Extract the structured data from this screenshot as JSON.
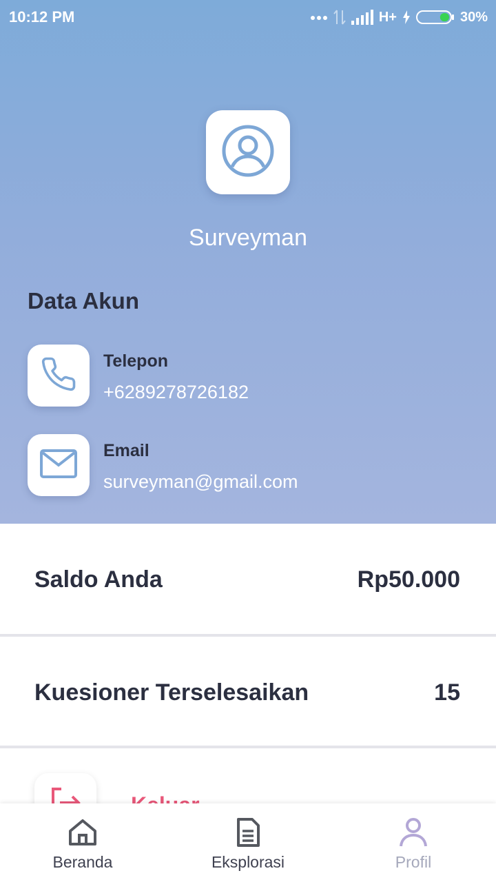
{
  "status_bar": {
    "time": "10:12 PM",
    "network": "H+",
    "battery": "30%",
    "battery_level": 0.3
  },
  "profile": {
    "name": "Surveyman"
  },
  "account": {
    "title": "Data Akun",
    "phone_label": "Telepon",
    "phone_value": "+6289278726182",
    "email_label": "Email",
    "email_value": "surveyman@gmail.com"
  },
  "stats": {
    "balance_label": "Saldo Anda",
    "balance_value": "Rp50.000",
    "completed_label": "Kuesioner Terselesaikan",
    "completed_value": "15"
  },
  "logout": {
    "label": "Keluar"
  },
  "nav": {
    "items": [
      {
        "label": "Beranda",
        "icon": "home-icon"
      },
      {
        "label": "Eksplorasi",
        "icon": "document-icon"
      },
      {
        "label": "Profil",
        "icon": "user-icon",
        "active": true
      }
    ]
  },
  "colors": {
    "header_top": "#7eabd9",
    "header_bottom": "#a4b5de",
    "icon_blue": "#7da7d6",
    "logout_red": "#e9587a",
    "text_dark": "#2b2f40"
  }
}
